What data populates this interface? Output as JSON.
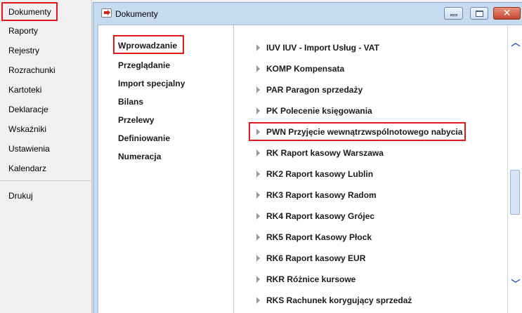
{
  "nav": {
    "items": [
      {
        "label": "Dokumenty"
      },
      {
        "label": "Raporty"
      },
      {
        "label": "Rejestry"
      },
      {
        "label": "Rozrachunki"
      },
      {
        "label": "Kartoteki"
      },
      {
        "label": "Deklaracje"
      },
      {
        "label": "Wskaźniki"
      },
      {
        "label": "Ustawienia"
      },
      {
        "label": "Kalendarz"
      },
      {
        "label": "Drukuj"
      }
    ]
  },
  "window": {
    "title": "Dokumenty",
    "close_glyph": "✕",
    "icon": "document-arrow-icon"
  },
  "submenu": {
    "items": [
      {
        "label": "Wprowadzanie"
      },
      {
        "label": "Przeglądanie"
      },
      {
        "label": "Import specjalny"
      },
      {
        "label": "Bilans"
      },
      {
        "label": "Przelewy"
      },
      {
        "label": "Definiowanie"
      },
      {
        "label": "Numeracja"
      }
    ]
  },
  "documents": {
    "items": [
      {
        "label": "IUV IUV - Import Usług - VAT"
      },
      {
        "label": "KOMP Kompensata"
      },
      {
        "label": "PAR Paragon sprzedaży"
      },
      {
        "label": "PK Polecenie księgowania"
      },
      {
        "label": "PWN Przyjęcie wewnątrzwspólnotowego nabycia"
      },
      {
        "label": "RK Raport kasowy Warszawa"
      },
      {
        "label": "RK2 Raport kasowy Lublin"
      },
      {
        "label": "RK3 Raport kasowy Radom"
      },
      {
        "label": "RK4 Raport kasowy Grójec"
      },
      {
        "label": "RK5 Raport Kasowy Płock"
      },
      {
        "label": "RK6 Raport kasowy EUR"
      },
      {
        "label": "RKR Różnice kursowe"
      },
      {
        "label": "RKS Rachunek korygujący sprzedaż"
      }
    ]
  },
  "scrollbar": {
    "up_glyph": "︿",
    "down_glyph": "﹀"
  },
  "colors": {
    "highlight": "#e0191e",
    "window_frame": "#c7dbf0",
    "accent_underline": "#3a6fc4"
  }
}
